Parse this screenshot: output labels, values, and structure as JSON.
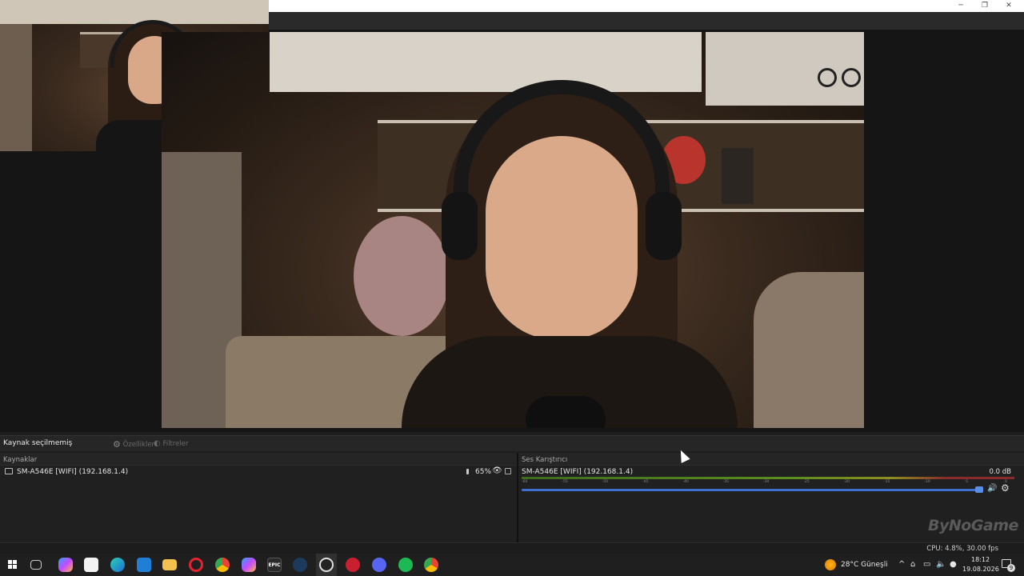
{
  "window": {
    "minimize": "─",
    "maximize": "❐",
    "close": "✕"
  },
  "properties_bar": {
    "no_selection": "Kaynak seçilmemiş",
    "properties_label": "Özellikler",
    "filters_label": "Filtreler"
  },
  "sources_dock": {
    "title": "Kaynaklar",
    "items": [
      {
        "name": "SM-A546E [WIFI] (192.168.1.4)",
        "volume": "65%",
        "icon": "camera-icon"
      }
    ]
  },
  "mixer_dock": {
    "title": "Ses Karıştırıcı",
    "channel": {
      "name": "SM-A546E [WIFI] (192.168.1.4)",
      "db": "0.0 dB",
      "fader_level": 0.94,
      "ticks": [
        "-60",
        "-55",
        "-50",
        "-45",
        "-40",
        "-35",
        "-30",
        "-25",
        "-20",
        "-15",
        "-10",
        "-5",
        "0"
      ]
    }
  },
  "watermark": "ByNoGame",
  "status": {
    "cpu_fps": "CPU: 4.8%, 30.00 fps"
  },
  "taskbar": {
    "apps": [
      "windows-start-icon",
      "task-view-icon",
      "copilot-icon",
      "store-icon",
      "edge-icon",
      "mail-icon",
      "file-explorer-icon",
      "opera-icon",
      "chrome-icon",
      "copilot-app-icon",
      "epic-games-icon",
      "steam-icon",
      "obs-icon",
      "riot-icon",
      "discord-icon",
      "spotify-icon",
      "chrome-profile-icon"
    ],
    "epic_label": "EPIC",
    "weather": "28°C Güneşli",
    "time": "18:12",
    "date": "19.08.2026",
    "notification_count": "9"
  },
  "colors": {
    "accent": "#3b6fd0",
    "background": "#1e1e1e",
    "taskbar": "#1f1f1f"
  }
}
